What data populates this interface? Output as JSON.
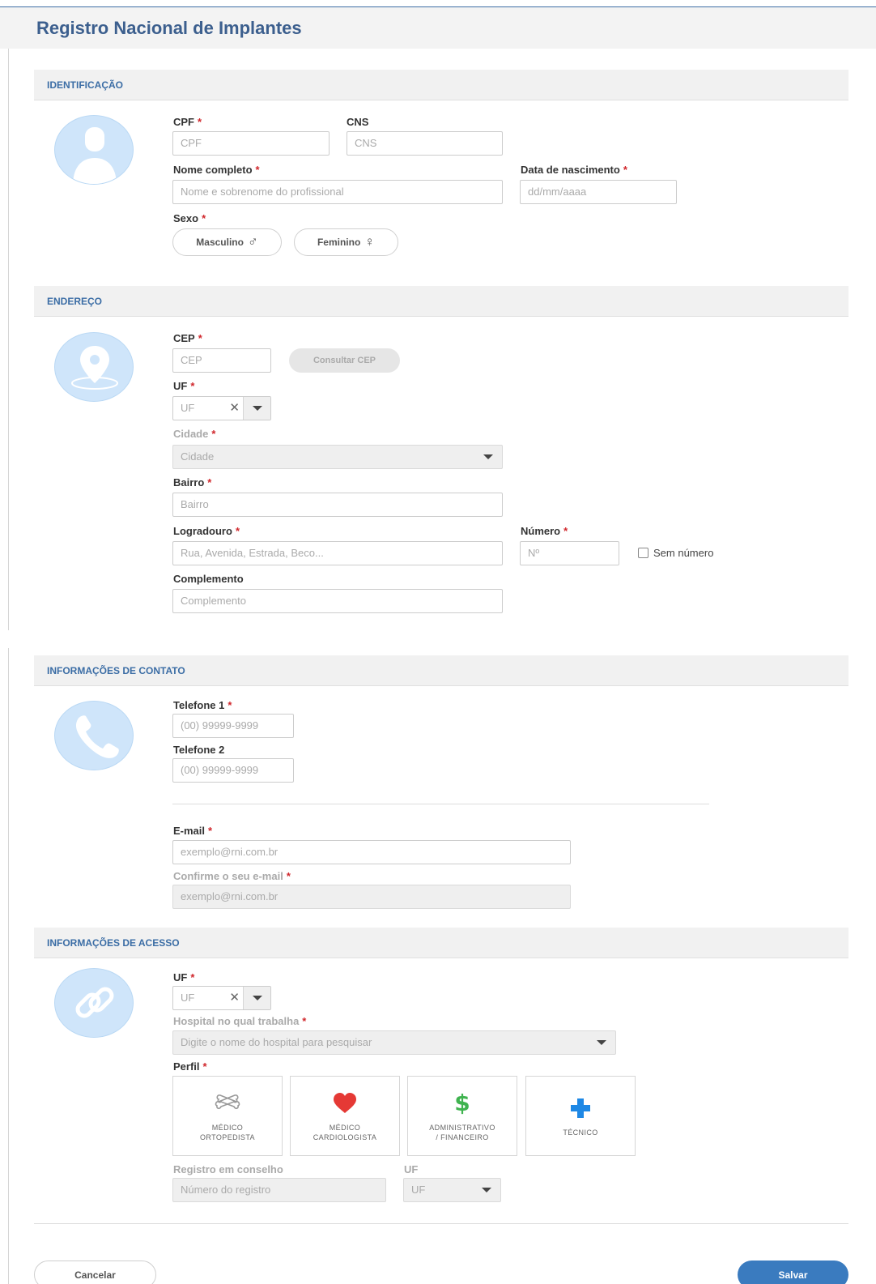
{
  "app": {
    "title": "Registro Nacional de Implantes"
  },
  "identificacao": {
    "section_title": "IDENTIFICAÇÃO",
    "cpf_label": "CPF",
    "cpf_placeholder": "CPF",
    "cns_label": "CNS",
    "cns_placeholder": "CNS",
    "nome_label": "Nome completo",
    "nome_placeholder": "Nome e sobrenome do profissional",
    "nascimento_label": "Data de nascimento",
    "nascimento_placeholder": "dd/mm/aaaa",
    "sexo_label": "Sexo",
    "masculino_label": "Masculino",
    "masculino_symbol": "♂",
    "feminino_label": "Feminino",
    "feminino_symbol": "♀"
  },
  "endereco": {
    "section_title": "ENDEREÇO",
    "cep_label": "CEP",
    "cep_placeholder": "CEP",
    "consultar_cep": "Consultar CEP",
    "uf_label": "UF",
    "uf_placeholder": "UF",
    "cidade_label": "Cidade",
    "cidade_placeholder": "Cidade",
    "bairro_label": "Bairro",
    "bairro_placeholder": "Bairro",
    "logradouro_label": "Logradouro",
    "logradouro_placeholder": "Rua, Avenida, Estrada, Beco...",
    "numero_label": "Número",
    "numero_placeholder": "Nº",
    "sem_numero_label": "Sem número",
    "complemento_label": "Complemento",
    "complemento_placeholder": "Complemento"
  },
  "contato": {
    "section_title": "INFORMAÇÕES DE CONTATO",
    "telefone1_label": "Telefone 1",
    "telefone1_placeholder": "(00) 99999-9999",
    "telefone2_label": "Telefone 2",
    "telefone2_placeholder": "(00) 99999-9999",
    "email_label": "E-mail",
    "email_placeholder": "exemplo@rni.com.br",
    "confirm_email_label": "Confirme o seu e-mail",
    "confirm_email_placeholder": "exemplo@rni.com.br"
  },
  "acesso": {
    "section_title": "INFORMAÇÕES DE ACESSO",
    "uf_label": "UF",
    "uf_placeholder": "UF",
    "hospital_label": "Hospital no qual trabalha",
    "hospital_placeholder": "Digite o nome do hospital para pesquisar",
    "perfil_label": "Perfil",
    "perfis": [
      {
        "label": "MÉDICO\nORTOPEDISTA",
        "icon": "bones-icon"
      },
      {
        "label": "MÉDICO\nCARDIOLOGISTA",
        "icon": "heart-icon",
        "color": "#e53935"
      },
      {
        "label": "ADMINISTRATIVO\n/ FINANCEIRO",
        "icon": "dollar-icon",
        "color": "#3fb34f"
      },
      {
        "label": "TÉCNICO",
        "icon": "plus-icon",
        "color": "#1e88e5"
      }
    ],
    "registro_label": "Registro em conselho",
    "registro_placeholder": "Número do registro",
    "registro_uf_label": "UF",
    "registro_uf_placeholder": "UF"
  },
  "actions": {
    "cancel": "Cancelar",
    "save": "Salvar"
  },
  "colors": {
    "primary": "#3a7bbf",
    "required": "#d0262b",
    "section_bg": "#f1f1f1",
    "avatar_bg": "#cfe5fa"
  }
}
